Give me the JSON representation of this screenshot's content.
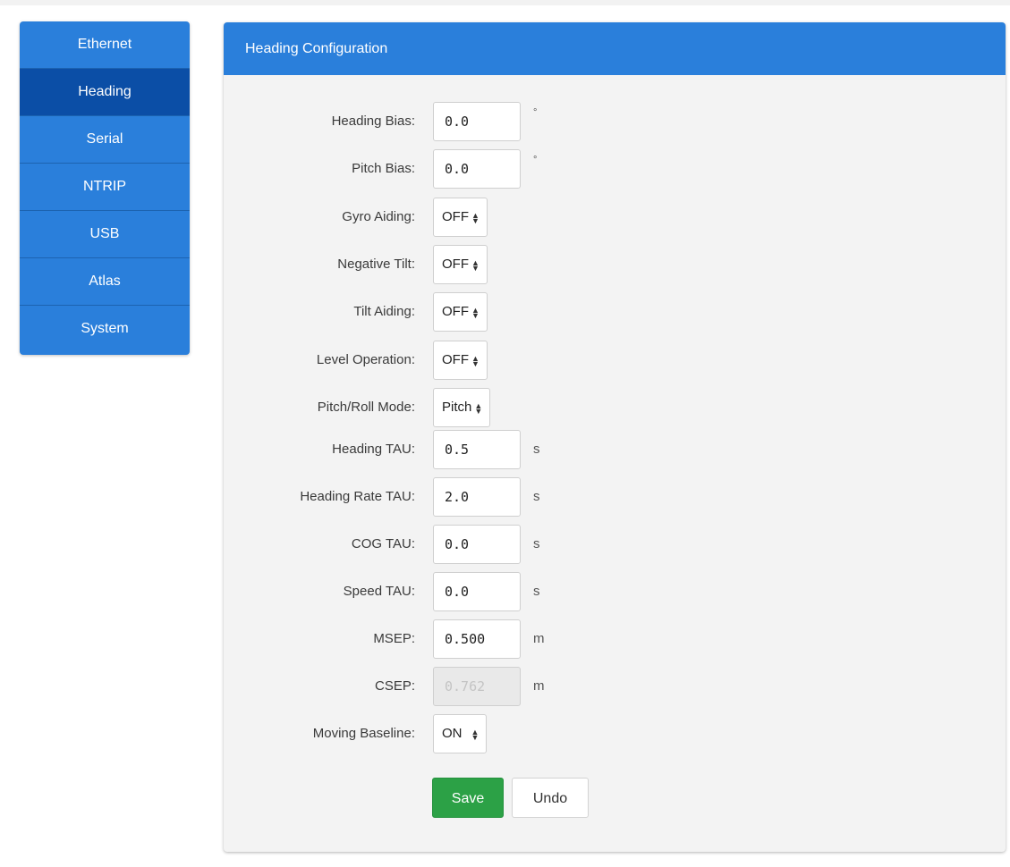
{
  "sidebar": {
    "items": [
      {
        "label": "Ethernet"
      },
      {
        "label": "Heading"
      },
      {
        "label": "Serial"
      },
      {
        "label": "NTRIP"
      },
      {
        "label": "USB"
      },
      {
        "label": "Atlas"
      },
      {
        "label": "System"
      }
    ],
    "active": "Heading"
  },
  "panel": {
    "title": "Heading Configuration"
  },
  "fields": {
    "heading_bias": {
      "label": "Heading Bias:",
      "value": "0.0",
      "unit": "°"
    },
    "pitch_bias": {
      "label": "Pitch Bias:",
      "value": "0.0",
      "unit": "°"
    },
    "gyro_aiding": {
      "label": "Gyro Aiding:",
      "value": "OFF"
    },
    "negative_tilt": {
      "label": "Negative Tilt:",
      "value": "OFF"
    },
    "tilt_aiding": {
      "label": "Tilt Aiding:",
      "value": "OFF"
    },
    "level_operation": {
      "label": "Level Operation:",
      "value": "OFF"
    },
    "pitch_roll_mode": {
      "label": "Pitch/Roll Mode:",
      "value": "Pitch"
    },
    "heading_tau": {
      "label": "Heading TAU:",
      "value": "0.5",
      "unit": "s"
    },
    "heading_rate_tau": {
      "label": "Heading Rate TAU:",
      "value": "2.0",
      "unit": "s"
    },
    "cog_tau": {
      "label": "COG TAU:",
      "value": "0.0",
      "unit": "s"
    },
    "speed_tau": {
      "label": "Speed TAU:",
      "value": "0.0",
      "unit": "s"
    },
    "msep": {
      "label": "MSEP:",
      "value": "0.500",
      "unit": "m"
    },
    "csep": {
      "label": "CSEP:",
      "value": "0.762",
      "unit": "m"
    },
    "moving_baseline": {
      "label": "Moving Baseline:",
      "value": "ON"
    }
  },
  "buttons": {
    "save": "Save",
    "undo": "Undo"
  },
  "colors": {
    "accent": "#2a7fdb",
    "sidebar_active": "#0b4ea6",
    "save_button": "#2ca146",
    "panel_background": "#f3f3f3"
  },
  "icons": {
    "select_arrow": "sort-arrows-icon"
  }
}
